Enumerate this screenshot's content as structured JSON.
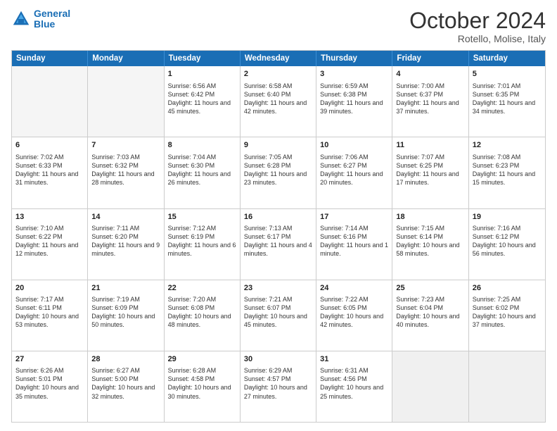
{
  "logo": {
    "line1": "General",
    "line2": "Blue"
  },
  "title": "October 2024",
  "location": "Rotello, Molise, Italy",
  "header_days": [
    "Sunday",
    "Monday",
    "Tuesday",
    "Wednesday",
    "Thursday",
    "Friday",
    "Saturday"
  ],
  "rows": [
    [
      {
        "day": "",
        "text": "",
        "empty": true
      },
      {
        "day": "",
        "text": "",
        "empty": true
      },
      {
        "day": "1",
        "text": "Sunrise: 6:56 AM\nSunset: 6:42 PM\nDaylight: 11 hours and 45 minutes."
      },
      {
        "day": "2",
        "text": "Sunrise: 6:58 AM\nSunset: 6:40 PM\nDaylight: 11 hours and 42 minutes."
      },
      {
        "day": "3",
        "text": "Sunrise: 6:59 AM\nSunset: 6:38 PM\nDaylight: 11 hours and 39 minutes."
      },
      {
        "day": "4",
        "text": "Sunrise: 7:00 AM\nSunset: 6:37 PM\nDaylight: 11 hours and 37 minutes."
      },
      {
        "day": "5",
        "text": "Sunrise: 7:01 AM\nSunset: 6:35 PM\nDaylight: 11 hours and 34 minutes."
      }
    ],
    [
      {
        "day": "6",
        "text": "Sunrise: 7:02 AM\nSunset: 6:33 PM\nDaylight: 11 hours and 31 minutes."
      },
      {
        "day": "7",
        "text": "Sunrise: 7:03 AM\nSunset: 6:32 PM\nDaylight: 11 hours and 28 minutes."
      },
      {
        "day": "8",
        "text": "Sunrise: 7:04 AM\nSunset: 6:30 PM\nDaylight: 11 hours and 26 minutes."
      },
      {
        "day": "9",
        "text": "Sunrise: 7:05 AM\nSunset: 6:28 PM\nDaylight: 11 hours and 23 minutes."
      },
      {
        "day": "10",
        "text": "Sunrise: 7:06 AM\nSunset: 6:27 PM\nDaylight: 11 hours and 20 minutes."
      },
      {
        "day": "11",
        "text": "Sunrise: 7:07 AM\nSunset: 6:25 PM\nDaylight: 11 hours and 17 minutes."
      },
      {
        "day": "12",
        "text": "Sunrise: 7:08 AM\nSunset: 6:23 PM\nDaylight: 11 hours and 15 minutes."
      }
    ],
    [
      {
        "day": "13",
        "text": "Sunrise: 7:10 AM\nSunset: 6:22 PM\nDaylight: 11 hours and 12 minutes."
      },
      {
        "day": "14",
        "text": "Sunrise: 7:11 AM\nSunset: 6:20 PM\nDaylight: 11 hours and 9 minutes."
      },
      {
        "day": "15",
        "text": "Sunrise: 7:12 AM\nSunset: 6:19 PM\nDaylight: 11 hours and 6 minutes."
      },
      {
        "day": "16",
        "text": "Sunrise: 7:13 AM\nSunset: 6:17 PM\nDaylight: 11 hours and 4 minutes."
      },
      {
        "day": "17",
        "text": "Sunrise: 7:14 AM\nSunset: 6:16 PM\nDaylight: 11 hours and 1 minute."
      },
      {
        "day": "18",
        "text": "Sunrise: 7:15 AM\nSunset: 6:14 PM\nDaylight: 10 hours and 58 minutes."
      },
      {
        "day": "19",
        "text": "Sunrise: 7:16 AM\nSunset: 6:12 PM\nDaylight: 10 hours and 56 minutes."
      }
    ],
    [
      {
        "day": "20",
        "text": "Sunrise: 7:17 AM\nSunset: 6:11 PM\nDaylight: 10 hours and 53 minutes."
      },
      {
        "day": "21",
        "text": "Sunrise: 7:19 AM\nSunset: 6:09 PM\nDaylight: 10 hours and 50 minutes."
      },
      {
        "day": "22",
        "text": "Sunrise: 7:20 AM\nSunset: 6:08 PM\nDaylight: 10 hours and 48 minutes."
      },
      {
        "day": "23",
        "text": "Sunrise: 7:21 AM\nSunset: 6:07 PM\nDaylight: 10 hours and 45 minutes."
      },
      {
        "day": "24",
        "text": "Sunrise: 7:22 AM\nSunset: 6:05 PM\nDaylight: 10 hours and 42 minutes."
      },
      {
        "day": "25",
        "text": "Sunrise: 7:23 AM\nSunset: 6:04 PM\nDaylight: 10 hours and 40 minutes."
      },
      {
        "day": "26",
        "text": "Sunrise: 7:25 AM\nSunset: 6:02 PM\nDaylight: 10 hours and 37 minutes."
      }
    ],
    [
      {
        "day": "27",
        "text": "Sunrise: 6:26 AM\nSunset: 5:01 PM\nDaylight: 10 hours and 35 minutes."
      },
      {
        "day": "28",
        "text": "Sunrise: 6:27 AM\nSunset: 5:00 PM\nDaylight: 10 hours and 32 minutes."
      },
      {
        "day": "29",
        "text": "Sunrise: 6:28 AM\nSunset: 4:58 PM\nDaylight: 10 hours and 30 minutes."
      },
      {
        "day": "30",
        "text": "Sunrise: 6:29 AM\nSunset: 4:57 PM\nDaylight: 10 hours and 27 minutes."
      },
      {
        "day": "31",
        "text": "Sunrise: 6:31 AM\nSunset: 4:56 PM\nDaylight: 10 hours and 25 minutes."
      },
      {
        "day": "",
        "text": "",
        "empty": true,
        "shaded": true
      },
      {
        "day": "",
        "text": "",
        "empty": true,
        "shaded": true
      }
    ]
  ]
}
